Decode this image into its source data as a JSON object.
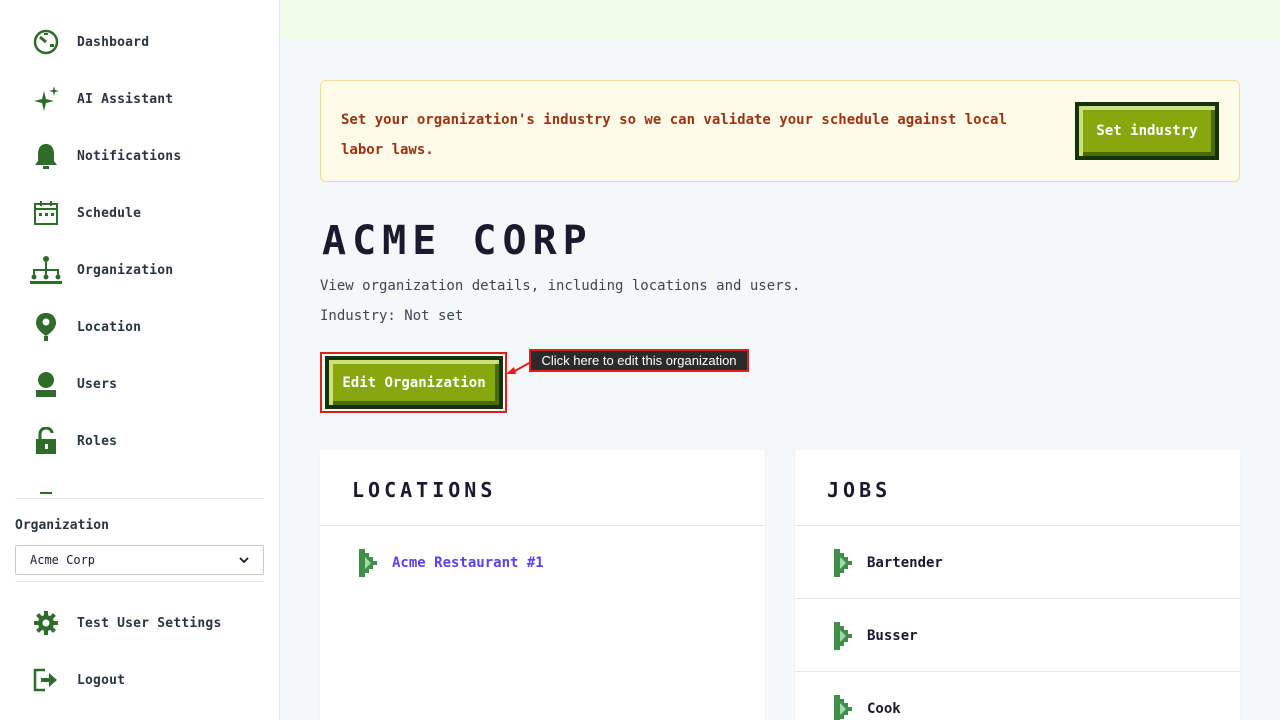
{
  "sidebar": {
    "items": [
      {
        "label": "Dashboard",
        "icon": "dashboard-icon"
      },
      {
        "label": "AI Assistant",
        "icon": "sparkle-icon"
      },
      {
        "label": "Notifications",
        "icon": "bell-icon"
      },
      {
        "label": "Schedule",
        "icon": "calendar-icon"
      },
      {
        "label": "Organization",
        "icon": "org-chart-icon"
      },
      {
        "label": "Location",
        "icon": "map-pin-icon"
      },
      {
        "label": "Users",
        "icon": "user-icon"
      },
      {
        "label": "Roles",
        "icon": "unlock-icon"
      }
    ],
    "org_label": "Organization",
    "org_select_value": "Acme Corp",
    "settings_label": "Test User Settings",
    "logout_label": "Logout"
  },
  "alert": {
    "text": "Set your organization's industry so we can validate your schedule against local labor laws.",
    "button_label": "Set industry"
  },
  "page": {
    "title": "ACME CORP",
    "subtitle": "View organization details, including locations and users.",
    "industry": "Industry: Not set",
    "edit_button_label": "Edit Organization",
    "tooltip": "Click here to edit this organization"
  },
  "locations": {
    "title": "LOCATIONS",
    "items": [
      "Acme Restaurant #1"
    ]
  },
  "jobs": {
    "title": "JOBS",
    "items": [
      "Bartender",
      "Busser",
      "Cook"
    ]
  },
  "colors": {
    "accent_green": "#86a80e",
    "icon_green": "#2f6b2a",
    "link_purple": "#5b3ff0",
    "alert_text": "#9a3412"
  }
}
